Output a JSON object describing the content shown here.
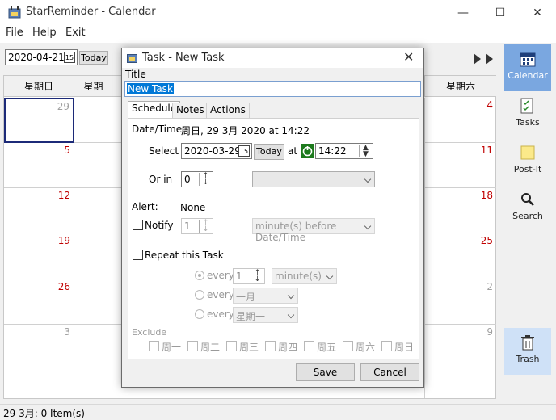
{
  "app": {
    "title": "StarReminder - Calendar"
  },
  "window_buttons": {
    "minimize": "—",
    "maximize": "☐",
    "close": "✕"
  },
  "menu": [
    "File",
    "Help",
    "Exit"
  ],
  "toolbar": {
    "date": "2020-04-21",
    "today": "Today",
    "cal_icon": "15"
  },
  "calendar": {
    "weekday_headers": [
      "星期日",
      "星期一",
      "星期六"
    ],
    "rows": [
      {
        "first": "29",
        "last": "4"
      },
      {
        "first": "5",
        "last": "11"
      },
      {
        "first": "12",
        "last": "18"
      },
      {
        "first": "19",
        "last": "25"
      },
      {
        "first": "26",
        "last": "2"
      },
      {
        "first": "3",
        "last": "9"
      }
    ]
  },
  "sidebar": [
    {
      "label": "Calendar",
      "icon": "calendar-icon"
    },
    {
      "label": "Tasks",
      "icon": "tasks-icon"
    },
    {
      "label": "Post-It",
      "icon": "post-it-icon"
    },
    {
      "label": "Search",
      "icon": "search-icon"
    },
    {
      "label": "Trash",
      "icon": "trash-icon"
    }
  ],
  "status": {
    "text": "29 3月: 0 Item(s)"
  },
  "dialog": {
    "title": "Task - New Task",
    "title_label": "Title",
    "title_value": "New Task",
    "tabs": [
      "Schedule",
      "Notes",
      "Actions"
    ],
    "datetime_label": "Date/Time:",
    "datetime_value": "周日, 29 3月 2020 at 14:22",
    "select_label": "Select",
    "select_date": "2020-03-29",
    "today": "Today",
    "at": "at",
    "time": "14:22",
    "orin_label": "Or in",
    "orin_value": "0",
    "alert_label": "Alert:",
    "alert_value": "None",
    "notify_label": "Notify",
    "notify_value": "1",
    "notify_unit": "minute(s) before Date/Time",
    "repeat_label": "Repeat this Task",
    "every": "every",
    "every1_value": "1",
    "every1_unit": "minute(s)",
    "every2_unit": "一月",
    "every3_unit": "星期一",
    "exclude_label": "Exclude",
    "exclude_days": [
      "周一",
      "周二",
      "周三",
      "周四",
      "周五",
      "周六",
      "周日"
    ],
    "save": "Save",
    "cancel": "Cancel"
  },
  "colors": {
    "accent": "#7aa7e0",
    "weekend_red": "#c00000",
    "selection": "#0078d7"
  }
}
